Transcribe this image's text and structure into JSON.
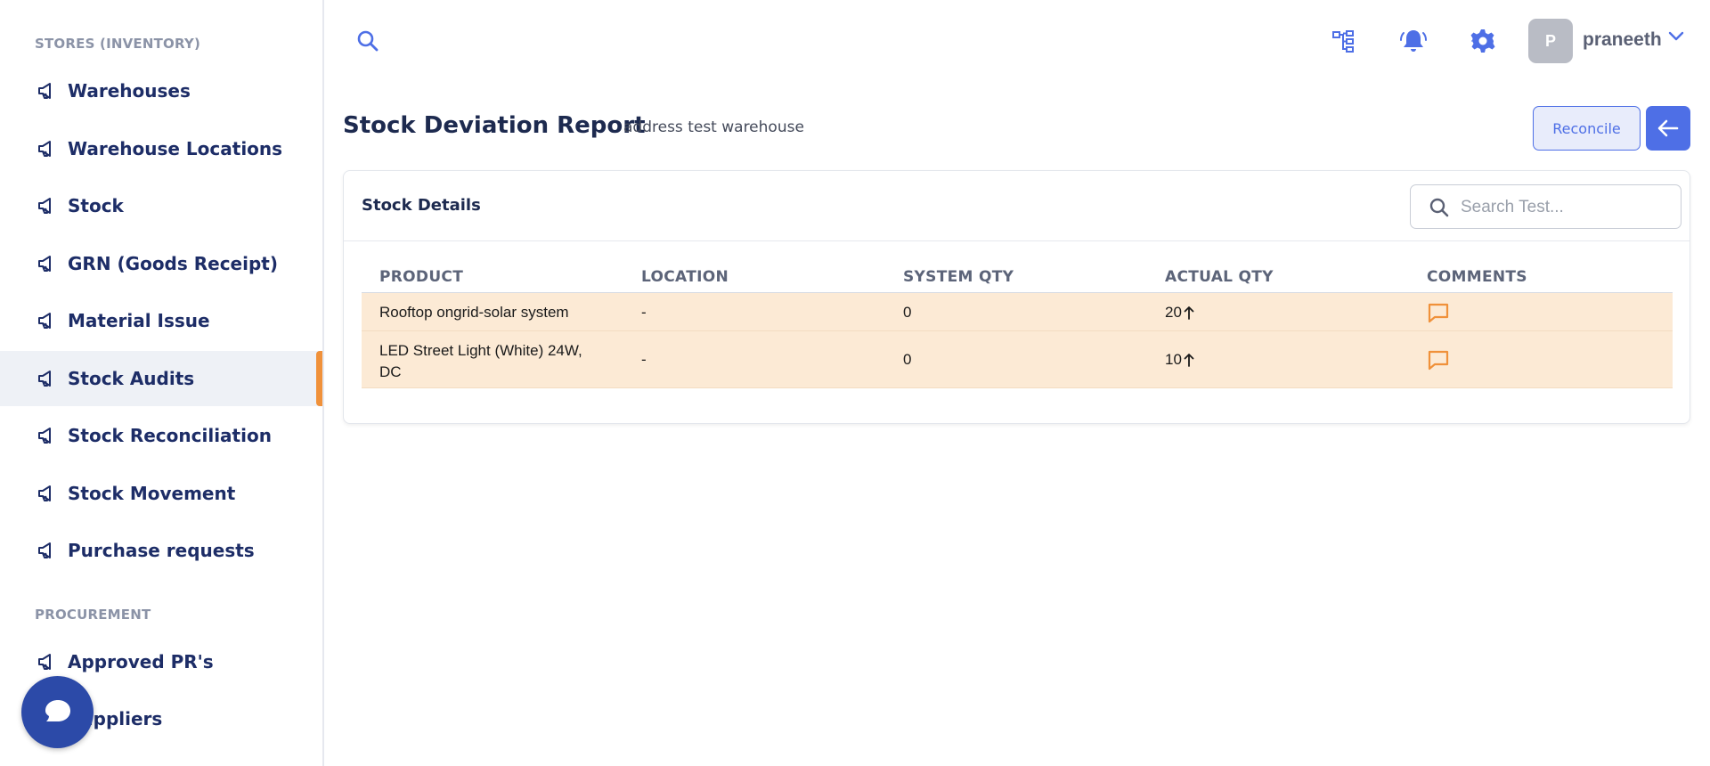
{
  "sidebar": {
    "sections": [
      {
        "title": "STORES (INVENTORY)"
      },
      {
        "title": "PROCUREMENT"
      }
    ],
    "items": [
      {
        "label": "Warehouses"
      },
      {
        "label": "Warehouse Locations"
      },
      {
        "label": "Stock"
      },
      {
        "label": "GRN (Goods Receipt)"
      },
      {
        "label": "Material Issue"
      },
      {
        "label": "Stock Audits",
        "active": true
      },
      {
        "label": "Stock Reconciliation"
      },
      {
        "label": "Stock Movement"
      },
      {
        "label": "Purchase requests"
      },
      {
        "label": "Approved PR's"
      },
      {
        "label": "Suppliers"
      }
    ]
  },
  "topbar": {
    "icons": [
      "search-icon",
      "org-chart-icon",
      "bell-icon",
      "gear-icon"
    ],
    "avatar_initial": "P",
    "user_name": "praneeth"
  },
  "header": {
    "title": "Stock Deviation Report",
    "subtitle": "address test warehouse",
    "reconcile_label": "Reconcile"
  },
  "card": {
    "title": "Stock Details",
    "search_placeholder": "Search Test...",
    "columns": [
      "PRODUCT",
      "LOCATION",
      "SYSTEM QTY",
      "ACTUAL QTY",
      "COMMENTS"
    ],
    "rows": [
      {
        "product": "Rooftop ongrid-solar system",
        "location": "-",
        "system_qty": "0",
        "actual_qty": "20"
      },
      {
        "product": "LED Street Light (White) 24W,\nDC",
        "location": "-",
        "system_qty": "0",
        "actual_qty": "10"
      }
    ]
  },
  "colors": {
    "accent": "#4e6fe6",
    "active_marker": "#f0913a",
    "row_highlight": "#fcead5",
    "comment_icon": "#f0913a",
    "chat_fab": "#2c4aa8"
  }
}
